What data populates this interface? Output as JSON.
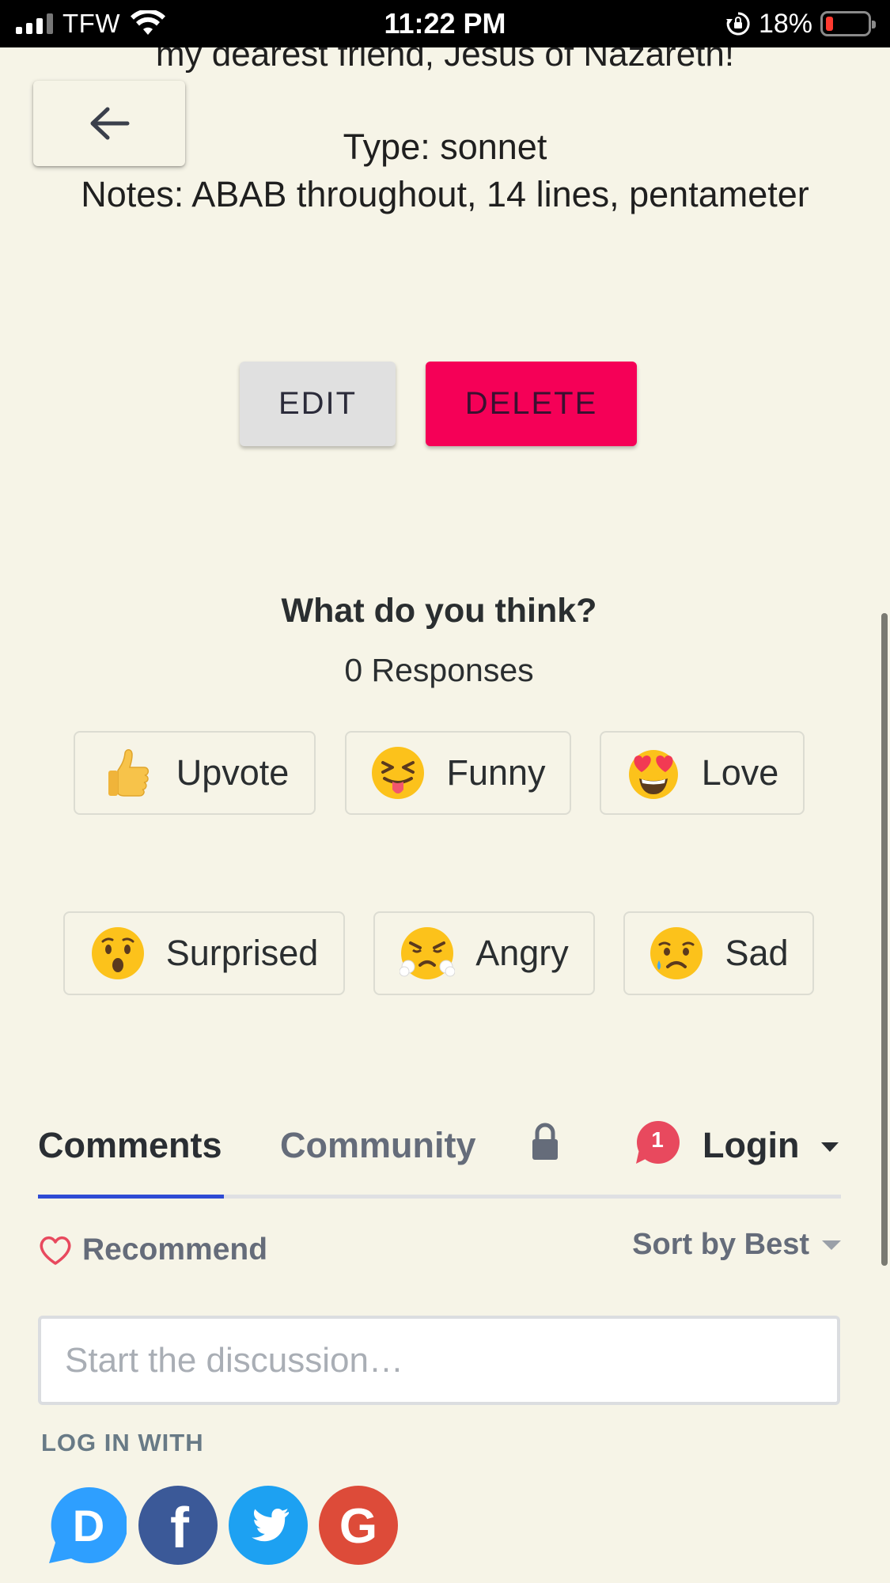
{
  "status_bar": {
    "carrier": "TFW",
    "time": "11:22 PM",
    "battery": "18%",
    "battery_level": 0.18,
    "battery_color": "#ff3b30"
  },
  "poem": {
    "partial_line": "my dearest friend, Jesus of Nazareth!",
    "type_line": "Type: sonnet",
    "notes_line": "Notes: ABAB throughout, 14 lines, pentameter"
  },
  "actions": {
    "back_icon": "arrow-left-icon",
    "edit_label": "EDIT",
    "delete_label": "DELETE",
    "delete_color": "#f50057"
  },
  "reactions": {
    "title": "What do you think?",
    "count": "0 Responses",
    "items": [
      {
        "label": "Upvote",
        "icon": "thumbs-up-icon"
      },
      {
        "label": "Funny",
        "icon": "tongue-out-face-icon"
      },
      {
        "label": "Love",
        "icon": "heart-eyes-face-icon"
      },
      {
        "label": "Surprised",
        "icon": "surprised-face-icon"
      },
      {
        "label": "Angry",
        "icon": "angry-face-icon"
      },
      {
        "label": "Sad",
        "icon": "sad-face-icon"
      }
    ]
  },
  "discussion": {
    "tabs": [
      {
        "label": "Comments",
        "active": true
      },
      {
        "label": "Community",
        "active": false
      }
    ],
    "notification_count": "1",
    "login_label": "Login",
    "recommend_label": "Recommend",
    "sort_label": "Sort by Best",
    "input_placeholder": "Start the discussion…",
    "login_with_label": "LOG IN WITH",
    "social_providers": [
      {
        "name": "Disqus",
        "letter": "D",
        "color": "#2e9fff"
      },
      {
        "name": "Facebook",
        "letter": "f",
        "color": "#3b5998"
      },
      {
        "name": "Twitter",
        "color": "#1da1f2"
      },
      {
        "name": "Google",
        "letter": "G",
        "color": "#dd4b39"
      }
    ],
    "accent_color": "#2e4bd4"
  }
}
